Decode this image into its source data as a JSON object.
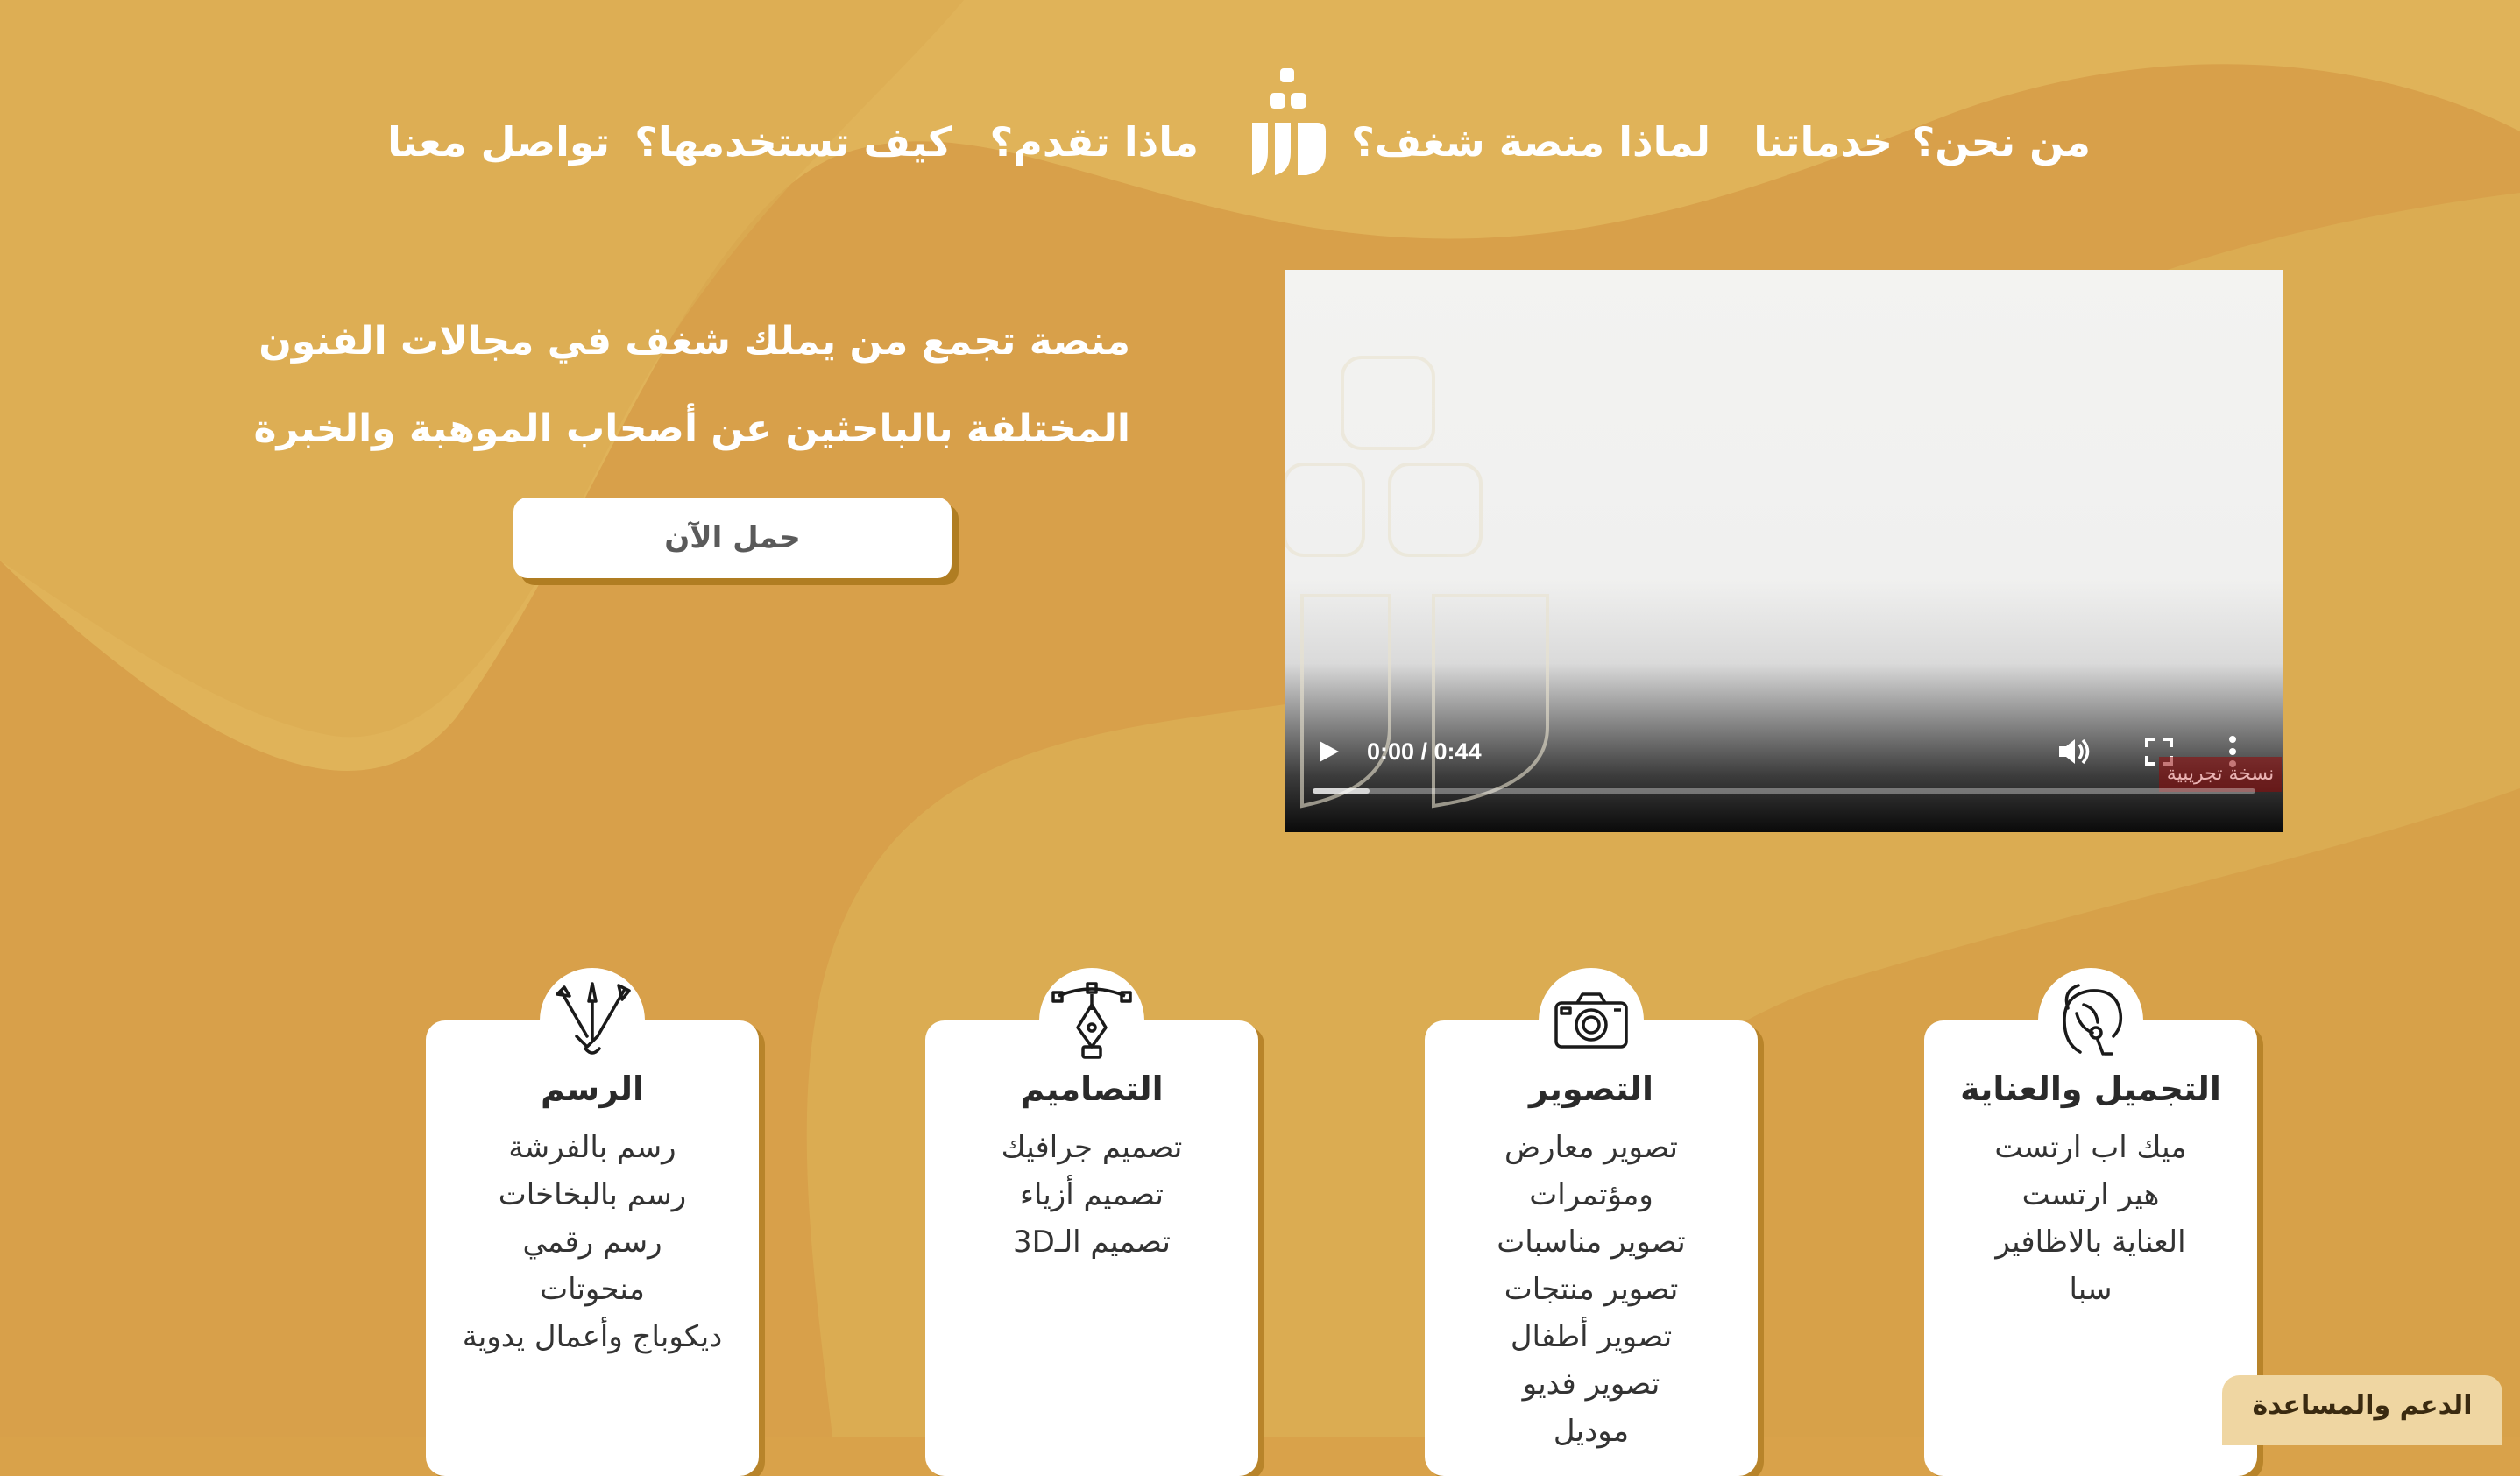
{
  "nav": {
    "items": [
      "من نحن؟",
      "خدماتنا",
      "لماذا منصة شغف؟",
      "ماذا تقدم؟",
      "كيف تستخدمها؟",
      "تواصل معنا"
    ]
  },
  "hero": {
    "line1": "منصة تجمع من يملك شغف في مجالات الفنون",
    "line2": "المختلفة بالباحثين عن أصحاب الموهبة والخبرة",
    "cta": "حمل الآن"
  },
  "video": {
    "time": "0:00 / 0:44",
    "progress_buffered_fraction": 0.06,
    "badge": "نسخة تجريبية"
  },
  "cards": [
    {
      "title": "التجميل والعناية",
      "icon": "beauty-icon",
      "items": [
        "ميك اب ارتست",
        "هير ارتست",
        "العناية بالاظافير",
        "سبا"
      ]
    },
    {
      "title": "التصوير",
      "icon": "camera-icon",
      "items": [
        "تصوير معارض",
        "ومؤتمرات",
        "تصوير مناسبات",
        "تصوير منتجات",
        "تصوير أطفال",
        "تصوير فديو",
        "موديل"
      ]
    },
    {
      "title": "التصاميم",
      "icon": "pen-tool-icon",
      "items": [
        "تصميم جرافيك",
        "تصميم أزياء",
        "تصميم الـ3D"
      ]
    },
    {
      "title": "الرسم",
      "icon": "brushes-icon",
      "items": [
        "رسم بالفرشة",
        "رسم بالبخاخات",
        "رسم رقمي",
        "منحوتات",
        "ديكوباج وأعمال يدوية"
      ]
    }
  ],
  "support": "الدعم والمساعدة",
  "colors": {
    "background": "#d9a24a",
    "wave": "#dcb558",
    "shadow": "#b8842a"
  }
}
